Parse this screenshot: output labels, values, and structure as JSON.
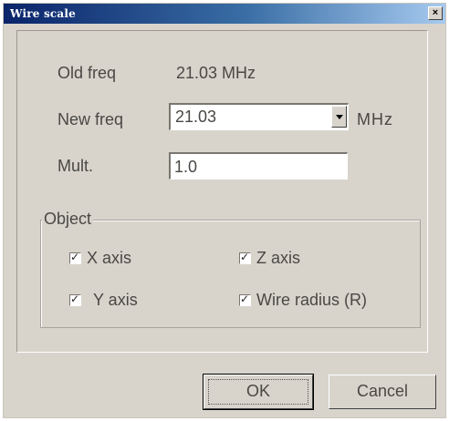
{
  "window": {
    "title": "Wire scale",
    "close_glyph": "×"
  },
  "old_freq": {
    "label": "Old freq",
    "value": "21.03 MHz"
  },
  "new_freq": {
    "label": "New freq",
    "value": "21.03",
    "unit": "MHz"
  },
  "mult": {
    "label": "Mult.",
    "value": "1.0"
  },
  "object_group": {
    "legend": "Object",
    "items": [
      {
        "label": "X axis",
        "checked": true
      },
      {
        "label": "Y axis",
        "checked": true
      },
      {
        "label": "Z axis",
        "checked": true
      },
      {
        "label": "Wire radius (R)",
        "checked": true
      }
    ]
  },
  "buttons": {
    "ok": "OK",
    "cancel": "Cancel"
  },
  "colors": {
    "dialog_bg": "#d8d4cc",
    "title_bar": "#0a246a",
    "text": "#4a4844"
  }
}
